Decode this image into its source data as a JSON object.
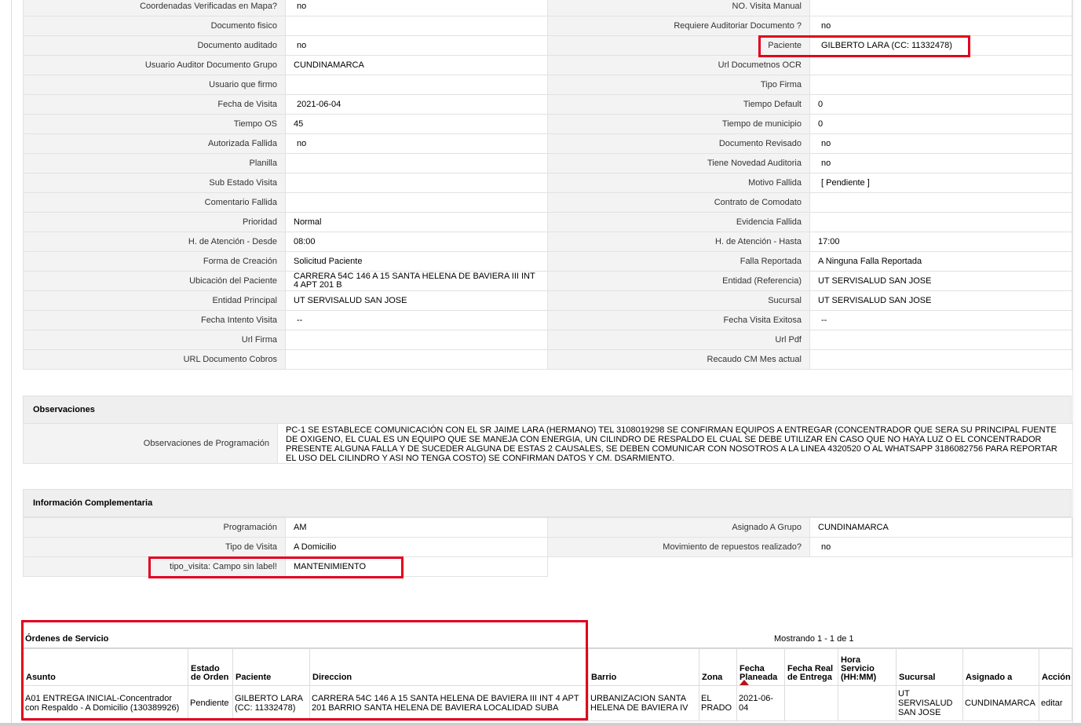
{
  "details": {
    "rows": [
      [
        "Coordenadas Verificadas en Mapa?",
        "no",
        "NO. Visita Manual",
        ""
      ],
      [
        "Documento fisico",
        "",
        "Requiere Auditoriar Documento ?",
        "no"
      ],
      [
        "Documento auditado",
        "no",
        "Paciente",
        "GILBERTO LARA (CC: 11332478)"
      ],
      [
        "Usuario Auditor Documento Grupo",
        "CUNDINAMARCA",
        "Url Documetnos OCR",
        ""
      ],
      [
        "Usuario que firmo",
        "",
        "Tipo Firma",
        ""
      ],
      [
        "Fecha de Visita",
        "2021-06-04",
        "Tiempo Default",
        "0"
      ],
      [
        "Tiempo OS",
        "45",
        "Tiempo de municipio",
        "0"
      ],
      [
        "Autorizada Fallida",
        "no",
        "Documento Revisado",
        "no"
      ],
      [
        "Planilla",
        "",
        "Tiene Novedad Auditoria",
        "no"
      ],
      [
        "Sub Estado Visita",
        "",
        "Motivo Fallida",
        "[ Pendiente ]"
      ],
      [
        "Comentario Fallida",
        "",
        "Contrato de Comodato",
        ""
      ],
      [
        "Prioridad",
        "Normal",
        "Evidencia Fallida",
        ""
      ],
      [
        "H. de Atención - Desde",
        "08:00",
        "H. de Atención - Hasta",
        "17:00"
      ],
      [
        "Forma de Creación",
        "Solicitud Paciente",
        "Falla Reportada",
        "A Ninguna Falla Reportada"
      ],
      [
        "Ubicación del Paciente",
        "CARRERA 54C 146 A 15 SANTA HELENA DE BAVIERA III INT 4 APT 201 B",
        "Entidad (Referencia)",
        "UT SERVISALUD SAN JOSE"
      ],
      [
        "Entidad Principal",
        "UT SERVISALUD SAN JOSE",
        "Sucursal",
        "UT SERVISALUD SAN JOSE"
      ],
      [
        "Fecha Intento Visita",
        "--",
        "Fecha Visita Exitosa",
        "--"
      ],
      [
        "Url Firma",
        "",
        "Url Pdf",
        ""
      ],
      [
        "URL Documento Cobros",
        "",
        "Recaudo CM Mes actual",
        ""
      ]
    ]
  },
  "observaciones": {
    "title": "Observaciones",
    "label": "Observaciones de Programación",
    "text": "   PC-1 SE ESTABLECE COMUNICACIÓN CON EL SR JAIME LARA (HERMANO) TEL 3108019298 SE CONFIRMAN EQUIPOS A ENTREGAR (CONCENTRADOR QUE SERA SU PRINCIPAL FUENTE DE OXIGENO, EL CUAL ES UN EQUIPO QUE SE MANEJA CON ENERGIA, UN CILINDRO DE RESPALDO EL CUAL SE DEBE UTILIZAR EN CASO QUE NO HAYA LUZ O EL CONCENTRADOR PRESENTE ALGUNA FALLA Y DE SUCEDER ALGUNA DE ESTAS 2 CAUSALES, SE DEBEN COMUNICAR CON NOSOTROS A LA LINEA 4320520 O AL WHATSAPP 3186082756 PARA REPORTAR EL USO DEL CILINDRO Y ASI NO TENGA COSTO) SE CONFIRMAN DATOS Y CM. DSARMIENTO."
  },
  "complementaria": {
    "title": "Información Complementaria",
    "rows": [
      [
        "Programación",
        "AM",
        "Asignado A Grupo",
        "CUNDINAMARCA"
      ],
      [
        "Tipo de Visita",
        "A Domicilio",
        "Movimiento de repuestos realizado?",
        "no"
      ],
      [
        "tipo_visita: Campo sin label!",
        "MANTENIMIENTO"
      ]
    ]
  },
  "orders": {
    "title": "Órdenes de Servicio",
    "count_text": "Mostrando 1 - 1 de 1",
    "headers": [
      "Asunto",
      "Estado de Orden",
      "Paciente",
      "Direccion",
      "Barrio",
      "Zona",
      "Fecha Planeada",
      "Fecha Real de Entrega",
      "Hora Servicio (HH:MM)",
      "Sucursal",
      "Asignado a",
      "Acción"
    ],
    "row": {
      "asunto": "A01 ENTREGA INICIAL-Concentrador con Respaldo - A Domicilio (130389926)",
      "estado": "Pendiente",
      "paciente": "GILBERTO LARA (CC: 11332478)",
      "direccion": "CARRERA 54C 146 A 15 SANTA HELENA DE BAVIERA III INT 4 APT 201 BARRIO SANTA HELENA DE BAVIERA LOCALIDAD SUBA",
      "barrio": "URBANIZACION SANTA HELENA DE BAVIERA IV",
      "zona": "EL PRADO",
      "fecha_planeada": "2021-06-04",
      "fecha_real": "",
      "hora": "",
      "sucursal": "UT SERVISALUD SAN JOSE",
      "asignado": "CUNDINAMARCA",
      "accion": "editar"
    }
  },
  "highlight_color": "#e1001c"
}
